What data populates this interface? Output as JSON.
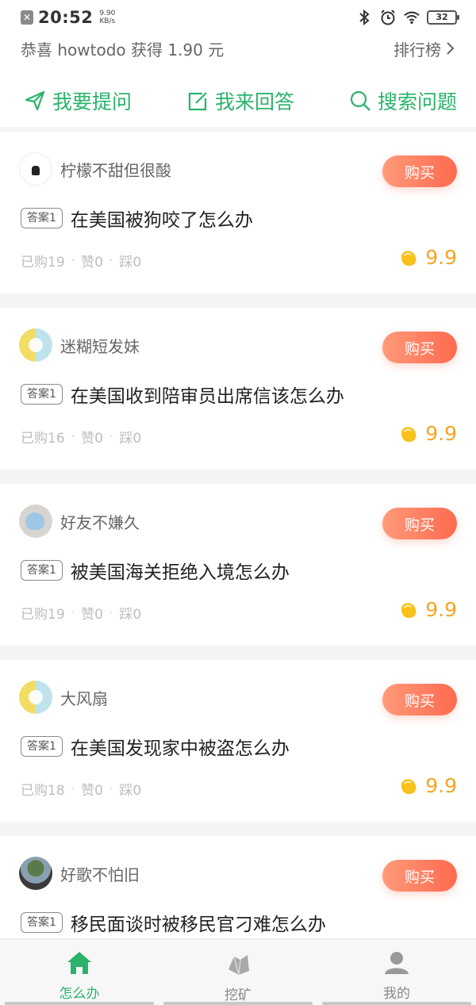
{
  "status_bar": {
    "time": "20:52",
    "net_speed_value": "9.90",
    "net_speed_unit": "KB/s",
    "battery": "32",
    "icons": [
      "notification-icon",
      "bluetooth-icon",
      "alarm-icon",
      "wifi-icon",
      "battery-icon"
    ]
  },
  "header": {
    "congrats_text": "恭喜 howtodo 获得 1.90 元",
    "ranking_label": "排行榜"
  },
  "actions": [
    {
      "label": "我要提问",
      "icon": "send-icon"
    },
    {
      "label": "我来回答",
      "icon": "edit-icon"
    },
    {
      "label": "搜索问题",
      "icon": "search-icon"
    }
  ],
  "colors": {
    "accent_green": "#2ab36a",
    "buy_orange": "#ff7a5c",
    "price_gold": "#f5a623"
  },
  "cards": [
    {
      "nickname": "柠檬不甜但很酸",
      "buy_label": "购买",
      "tag": "答案1",
      "question": "在美国被狗咬了怎么办",
      "bought": "已购19",
      "likes": "赞0",
      "dislikes": "踩0",
      "price": "9.9"
    },
    {
      "nickname": "迷糊短发妹",
      "buy_label": "购买",
      "tag": "答案1",
      "question": "在美国收到陪审员出席信该怎么办",
      "bought": "已购16",
      "likes": "赞0",
      "dislikes": "踩0",
      "price": "9.9"
    },
    {
      "nickname": "好友不嫌久",
      "buy_label": "购买",
      "tag": "答案1",
      "question": "被美国海关拒绝入境怎么办",
      "bought": "已购19",
      "likes": "赞0",
      "dislikes": "踩0",
      "price": "9.9"
    },
    {
      "nickname": "大风扇",
      "buy_label": "购买",
      "tag": "答案1",
      "question": "在美国发现家中被盗怎么办",
      "bought": "已购18",
      "likes": "赞0",
      "dislikes": "踩0",
      "price": "9.9"
    },
    {
      "nickname": "好歌不怕旧",
      "buy_label": "购买",
      "tag": "答案1",
      "question": "移民面谈时被移民官刁难怎么办",
      "bought": "",
      "likes": "",
      "dislikes": "",
      "price": ""
    }
  ],
  "tabbar": [
    {
      "label": "怎么办",
      "icon": "home-icon",
      "active": true
    },
    {
      "label": "挖矿",
      "icon": "mining-icon",
      "active": false
    },
    {
      "label": "我的",
      "icon": "profile-icon",
      "active": false
    }
  ]
}
